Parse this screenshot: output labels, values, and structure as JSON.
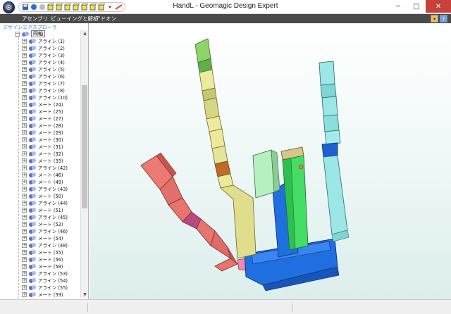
{
  "window": {
    "title": "HandL - Geomagic Design Expert",
    "minimize_glyph": "─",
    "maximize_glyph": "□",
    "close_glyph": "✕"
  },
  "menubar": {
    "tabs": [
      "アセンブリ",
      "ビューイングと解析",
      "アドオン"
    ],
    "help_glyph": "?"
  },
  "explorer": {
    "title": "デザインエクスプローラ",
    "root_label": "同軸",
    "items": [
      "アライン (1)",
      "アライン (2)",
      "アライン (3)",
      "アライン (4)",
      "アライン (5)",
      "アライン (6)",
      "アライン (7)",
      "アライン (8)",
      "アライン (10)",
      "メート (24)",
      "メート (25)",
      "メート (27)",
      "メート (28)",
      "メート (29)",
      "メート (30)",
      "メート (31)",
      "メート (32)",
      "メート (33)",
      "アライン (42)",
      "メート (46)",
      "メート (49)",
      "アライン (43)",
      "メート (50)",
      "アライン (44)",
      "メート (51)",
      "アライン (45)",
      "メート (52)",
      "アライン (46)",
      "メート (54)",
      "アライン (48)",
      "メート (55)",
      "メート (56)",
      "メート (58)",
      "アライン (53)",
      "アライン (54)",
      "アライン (55)",
      "メート (59)"
    ]
  },
  "colors": {
    "menubar": "#4a4a4a",
    "accent_blue": "#3b7ed3",
    "close_button": "#c7403a",
    "thumb_finger": "#e8746e",
    "index_finger": "#e6e49a",
    "middle_finger": "#b7f0c0",
    "ring_finger": "#44dd66",
    "pinky_finger": "#9be6e6",
    "palm": "#1f6fe0"
  },
  "icons": {
    "app_orb": "app-menu-icon",
    "qat": [
      "save-icon",
      "circle-icon",
      "circle-icon",
      "cube-icon",
      "cube-icon",
      "cube-icon",
      "cube-icon",
      "cube-icon",
      "cube-icon",
      "cube-icon",
      "dropdown-icon",
      "pencil-icon"
    ]
  }
}
